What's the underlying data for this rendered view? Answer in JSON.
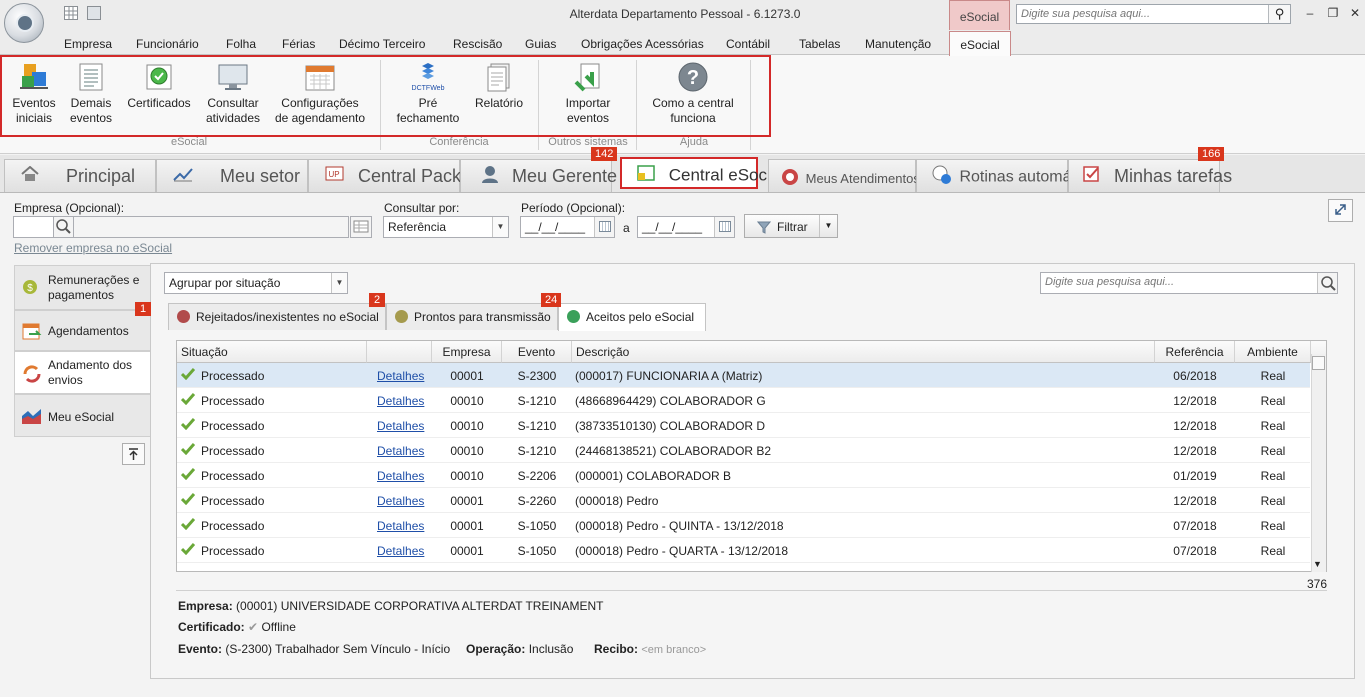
{
  "window": {
    "title": "Alterdata Departamento Pessoal - 6.1273.0",
    "context_tab": "eSocial",
    "search_placeholder": "Digite sua pesquisa aqui..."
  },
  "menu": [
    "Empresa",
    "Funcionário",
    "Folha",
    "Férias",
    "Décimo Terceiro",
    "Rescisão",
    "Guias",
    "Obrigações Acessórias",
    "Contábil",
    "Tabelas",
    "Manutenção",
    "eSocial"
  ],
  "ribbon": {
    "buttons": [
      {
        "label1": "Eventos",
        "label2": "iniciais",
        "icon": "initial-events-icon"
      },
      {
        "label1": "Demais",
        "label2": "eventos",
        "icon": "other-events-icon"
      },
      {
        "label1": "Certificados",
        "label2": "",
        "icon": "certificate-icon"
      },
      {
        "label1": "Consultar",
        "label2": "atividades",
        "icon": "monitor-icon"
      },
      {
        "label1": "Configurações",
        "label2": "de agendamento",
        "icon": "calendar-icon"
      },
      {
        "label1": "Pré",
        "label2": "fechamento",
        "icon": "dctfweb-icon",
        "icon_text": "DCTFWeb"
      },
      {
        "label1": "Relatório",
        "label2": "",
        "icon": "report-icon"
      },
      {
        "label1": "Importar",
        "label2": "eventos",
        "icon": "import-icon"
      },
      {
        "label1": "Como a central",
        "label2": "funciona",
        "icon": "help-icon"
      }
    ],
    "groups": [
      "eSocial",
      "Conferência",
      "Outros sistemas",
      "Ajuda"
    ]
  },
  "main_tabs": {
    "principal": "Principal",
    "meu_setor": "Meu setor",
    "central_packup": "Central PackUp",
    "meu_gerente": "Meu Gerente",
    "central_esocial": "Central eSocial",
    "meus_atendimentos": "Meus Atendimentos",
    "rotinas": "Rotinas automáticas",
    "minhas_tarefas": "Minhas tarefas",
    "badge_central_esocial": "142",
    "badge_minhas_tarefas": "166"
  },
  "filters": {
    "empresa_label": "Empresa (Opcional):",
    "consultar_label": "Consultar por:",
    "consultar_value": "Referência",
    "periodo_label": "Período (Opcional):",
    "date_from": "__/__/____",
    "date_to": "__/__/____",
    "a_label": "a",
    "filtrar": "Filtrar",
    "remover_link": "Remover empresa no eSocial"
  },
  "left_nav": {
    "remuneracoes1": "Remunerações e",
    "remuneracoes2": "pagamentos",
    "agendamentos": "Agendamentos",
    "agendamentos_badge": "1",
    "andamento1": "Andamento dos",
    "andamento2": "envios",
    "meu_esocial": "Meu eSocial"
  },
  "content": {
    "group_by": "Agrupar por situação",
    "search_placeholder": "Digite sua pesquisa aqui...",
    "subtabs": {
      "rejeitados": "Rejeitados/inexistentes no eSocial",
      "prontos": "Prontos para transmissão",
      "aceitos": "Aceitos pelo eSocial",
      "badge_rejeitados": "2",
      "badge_prontos": "24"
    },
    "colors": {
      "rejeitados": "#b14b4b",
      "prontos": "#a59a4d",
      "aceitos": "#3aa05a"
    },
    "columns": [
      "Situação",
      "",
      "Empresa",
      "Evento",
      "Descrição",
      "Referência",
      "Ambiente"
    ],
    "rows": [
      {
        "situacao": "Processado",
        "detalhes": "Detalhes",
        "empresa": "00001",
        "evento": "S-2300",
        "descricao": "(000017) FUNCIONARIA A (Matriz)",
        "referencia": "06/2018",
        "ambiente": "Real"
      },
      {
        "situacao": "Processado",
        "detalhes": "Detalhes",
        "empresa": "00010",
        "evento": "S-1210",
        "descricao": "(48668964429) COLABORADOR G",
        "referencia": "12/2018",
        "ambiente": "Real"
      },
      {
        "situacao": "Processado",
        "detalhes": "Detalhes",
        "empresa": "00010",
        "evento": "S-1210",
        "descricao": "(38733510130) COLABORADOR D",
        "referencia": "12/2018",
        "ambiente": "Real"
      },
      {
        "situacao": "Processado",
        "detalhes": "Detalhes",
        "empresa": "00010",
        "evento": "S-1210",
        "descricao": "(24468138521) COLABORADOR B2",
        "referencia": "12/2018",
        "ambiente": "Real"
      },
      {
        "situacao": "Processado",
        "detalhes": "Detalhes",
        "empresa": "00010",
        "evento": "S-2206",
        "descricao": "(000001) COLABORADOR B",
        "referencia": "01/2019",
        "ambiente": "Real"
      },
      {
        "situacao": "Processado",
        "detalhes": "Detalhes",
        "empresa": "00001",
        "evento": "S-2260",
        "descricao": "(000018) Pedro",
        "referencia": "12/2018",
        "ambiente": "Real"
      },
      {
        "situacao": "Processado",
        "detalhes": "Detalhes",
        "empresa": "00001",
        "evento": "S-1050",
        "descricao": "(000018) Pedro - QUINTA - 13/12/2018",
        "referencia": "07/2018",
        "ambiente": "Real"
      },
      {
        "situacao": "Processado",
        "detalhes": "Detalhes",
        "empresa": "00001",
        "evento": "S-1050",
        "descricao": "(000018) Pedro - QUARTA - 13/12/2018",
        "referencia": "07/2018",
        "ambiente": "Real"
      }
    ],
    "row_count": "376",
    "info": {
      "empresa_label": "Empresa:",
      "empresa_value": "(00001) UNIVERSIDADE CORPORATIVA ALTERDAT TREINAMENT",
      "certificado_label": "Certificado:",
      "certificado_value": "Offline",
      "evento_label": "Evento:",
      "evento_value": "(S-2300) Trabalhador Sem Vínculo - Início",
      "operacao_label": "Operação:",
      "operacao_value": "Inclusão",
      "recibo_label": "Recibo:",
      "recibo_value": "<em branco>"
    }
  }
}
